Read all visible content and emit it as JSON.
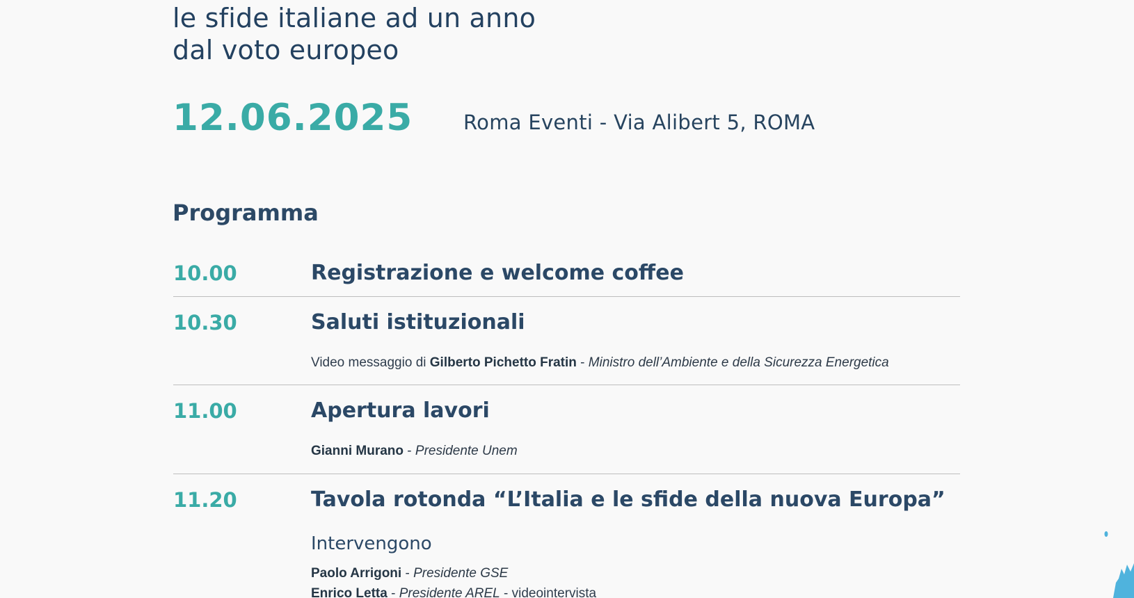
{
  "header": {
    "subtitle_line1": "le sfide italiane ad un anno",
    "subtitle_line2": "dal voto europeo",
    "date": "12.06.2025",
    "venue": "Roma Eventi - Via Alibert 5, ROMA"
  },
  "programma": {
    "heading": "Programma",
    "items": [
      {
        "time": "10.00",
        "title": "Registrazione e welcome coffee"
      },
      {
        "time": "10.30",
        "title": "Saluti istituzionali",
        "detail_prefix": "Video messaggio di ",
        "detail_name": "Gilberto Pichetto Fratin",
        "detail_sep": " - ",
        "detail_role": "Ministro dell’Ambiente e della Sicurezza Energetica"
      },
      {
        "time": "11.00",
        "title": "Apertura lavori",
        "detail_name": "Gianni Murano",
        "detail_sep": " - ",
        "detail_role": "Presidente Unem"
      },
      {
        "time": "11.20",
        "title": "Tavola rotonda “L’Italia e le sfide della nuova Europa”",
        "intervengono": "Intervengono",
        "speakers": [
          {
            "name": "Paolo Arrigoni",
            "sep": " - ",
            "role": "Presidente GSE"
          },
          {
            "name": "Enrico Letta",
            "sep": " - ",
            "role": "Presidente AREL",
            "extra": " - videointervista"
          }
        ]
      }
    ]
  },
  "colors": {
    "teal": "#3aaba6",
    "navy": "#2b4866",
    "rule": "#bdbdbd",
    "splash": "#4fb3dd"
  },
  "icons": {
    "decoration": "paint-splash"
  }
}
